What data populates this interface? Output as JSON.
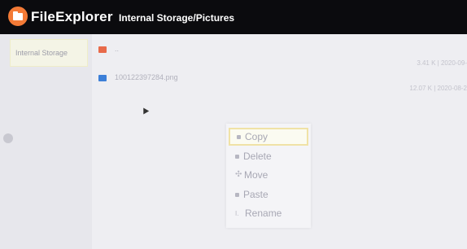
{
  "app": {
    "title": "FileExplorer",
    "path": "Internal Storage/Pictures",
    "logo_icon": "folder-icon",
    "accent": "#f37a36"
  },
  "sidebar": {
    "items": [
      {
        "label": "Internal Storage",
        "selected": true
      }
    ]
  },
  "files": [
    {
      "name": "..",
      "icon": "folder-icon",
      "meta": "3.41 K | 2020-09-"
    },
    {
      "name": "100122397284.png",
      "icon": "image-icon",
      "meta": "12.07 K | 2020-08-2"
    }
  ],
  "context_menu": {
    "items": [
      {
        "label": "Copy",
        "icon": "copy-icon",
        "focused": true
      },
      {
        "label": "Delete",
        "icon": "delete-icon"
      },
      {
        "label": "Move",
        "icon": "move-icon",
        "glyph": "✣"
      },
      {
        "label": "Paste",
        "icon": "paste-icon"
      },
      {
        "label": "Rename",
        "icon": "rename-icon",
        "glyph": "I."
      }
    ]
  }
}
